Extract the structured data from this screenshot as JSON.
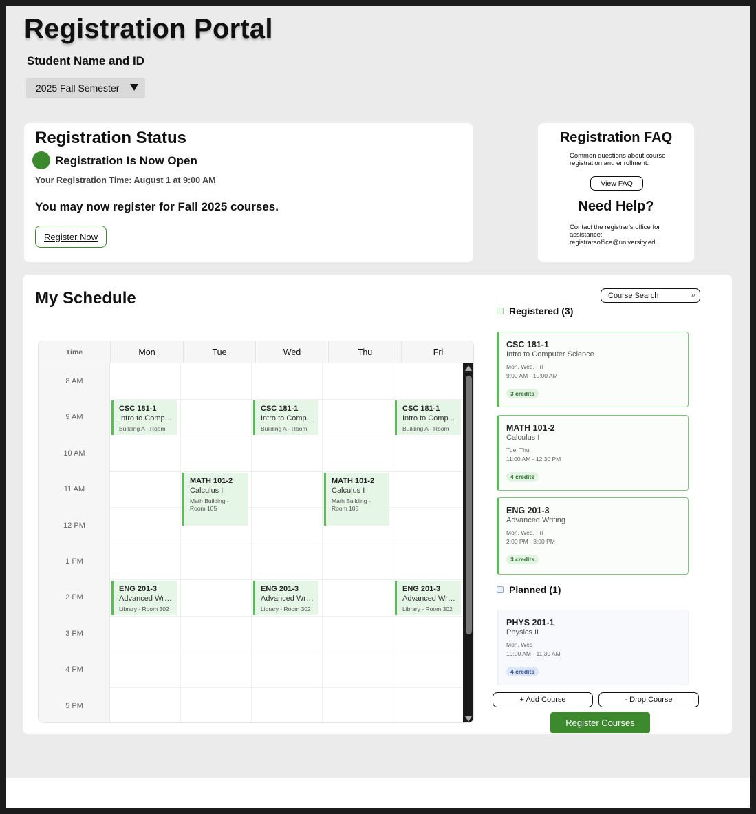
{
  "app": {
    "title": "Registration Portal",
    "student": "Student Name and ID",
    "semester": "2025 Fall Semester"
  },
  "status": {
    "heading": "Registration Status",
    "state": "Registration Is Now Open",
    "time": "Your Registration Time: August  1 at 9:00 AM",
    "message": "You may now register for Fall 2025 courses.",
    "button": "Register Now",
    "dot_color": "#3d8a2e"
  },
  "faq": {
    "heading": "Registration FAQ",
    "description": "Common questions about course registration and enrollment.",
    "button": "View FAQ",
    "help_heading": "Need Help?",
    "help_text": "Contact the registrar's office for assistance: registrarsoffice@university.edu"
  },
  "schedule": {
    "heading": "My Schedule",
    "time_header": "Time",
    "days": [
      "Mon",
      "Tue",
      "Wed",
      "Thu",
      "Fri"
    ],
    "times": [
      "8 AM",
      "9 AM",
      "10 AM",
      "11 AM",
      "12 PM",
      "1 PM",
      "2 PM",
      "3 PM",
      "4 PM",
      "5 PM"
    ],
    "events": {
      "csc_mon": {
        "code": "CSC 181-1",
        "name": "Intro to Comp...",
        "room": "Building A - Room"
      },
      "csc_wed": {
        "code": "CSC 181-1",
        "name": "Intro to Comp...",
        "room": "Building A - Room"
      },
      "csc_fri": {
        "code": "CSC 181-1",
        "name": "Intro to Comp...",
        "room": "Building A - Room"
      },
      "math_tue": {
        "code": "MATH 101-2",
        "name": "Calculus I",
        "room": "Math Building - Room 105"
      },
      "math_thu": {
        "code": "MATH 101-2",
        "name": "Calculus I",
        "room": "Math Building - Room 105"
      },
      "eng_mon": {
        "code": "ENG 201-3",
        "name": "Advanced Writ...",
        "room": "Library - Room 302"
      },
      "eng_wed": {
        "code": "ENG 201-3",
        "name": "Advanced Writ...",
        "room": "Library - Room 302"
      },
      "eng_fri": {
        "code": "ENG 201-3",
        "name": "Advanced Writ...",
        "room": "Library - Room 302"
      }
    },
    "event_color": "#e6f6e6",
    "event_accent": "#5bbb5b"
  },
  "search": {
    "placeholder": "Course Search"
  },
  "registered": {
    "heading": "Registered (3)",
    "courses": [
      {
        "code": "CSC 181-1",
        "name": "Intro to Computer Science",
        "days": "Mon, Wed, Fri",
        "time": "9:00 AM - 10:00 AM",
        "credits": "3 credits"
      },
      {
        "code": "MATH 101-2",
        "name": "Calculus I",
        "days": "Tue, Thu",
        "time": "11:00 AM - 12:30 PM",
        "credits": "4 credits"
      },
      {
        "code": "ENG 201-3",
        "name": "Advanced Writing",
        "days": "Mon, Wed, Fri",
        "time": "2:00 PM - 3:00 PM",
        "credits": "3 credits"
      }
    ]
  },
  "planned": {
    "heading": "Planned (1)",
    "courses": [
      {
        "code": "PHYS 201-1",
        "name": "Physics II",
        "days": "Mon, Wed",
        "time": "10:00 AM - 11:30 AM",
        "credits": "4 credits"
      }
    ]
  },
  "actions": {
    "add": "+   Add Course",
    "drop": "-   Drop Course",
    "register": "Register Courses"
  }
}
